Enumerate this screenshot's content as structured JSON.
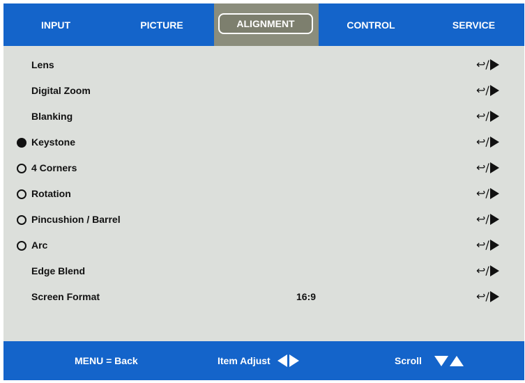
{
  "tabs": [
    {
      "label": "INPUT"
    },
    {
      "label": "PICTURE"
    },
    {
      "label": "ALIGNMENT",
      "active": true
    },
    {
      "label": "CONTROL"
    },
    {
      "label": "SERVICE"
    }
  ],
  "menu": {
    "items": [
      {
        "label": "Lens",
        "indicator": "none"
      },
      {
        "label": "Digital Zoom",
        "indicator": "none"
      },
      {
        "label": "Blanking",
        "indicator": "none"
      },
      {
        "label": "Keystone",
        "indicator": "filled"
      },
      {
        "label": "4 Corners",
        "indicator": "empty"
      },
      {
        "label": "Rotation",
        "indicator": "empty"
      },
      {
        "label": "Pincushion / Barrel",
        "indicator": "empty"
      },
      {
        "label": "Arc",
        "indicator": "empty"
      },
      {
        "label": "Edge Blend",
        "indicator": "none"
      },
      {
        "label": "Screen Format",
        "indicator": "none",
        "value": "16:9"
      }
    ],
    "action_symbol": "↩/",
    "action_icon": "enter-or-right-arrow-icon"
  },
  "footer": {
    "back_label": "MENU = Back",
    "adjust_label": "Item Adjust",
    "scroll_label": "Scroll"
  },
  "colors": {
    "bar": "#1464ca",
    "background": "#dcdfdb",
    "active_tab": "#8b8d7c",
    "text": "#111111"
  }
}
